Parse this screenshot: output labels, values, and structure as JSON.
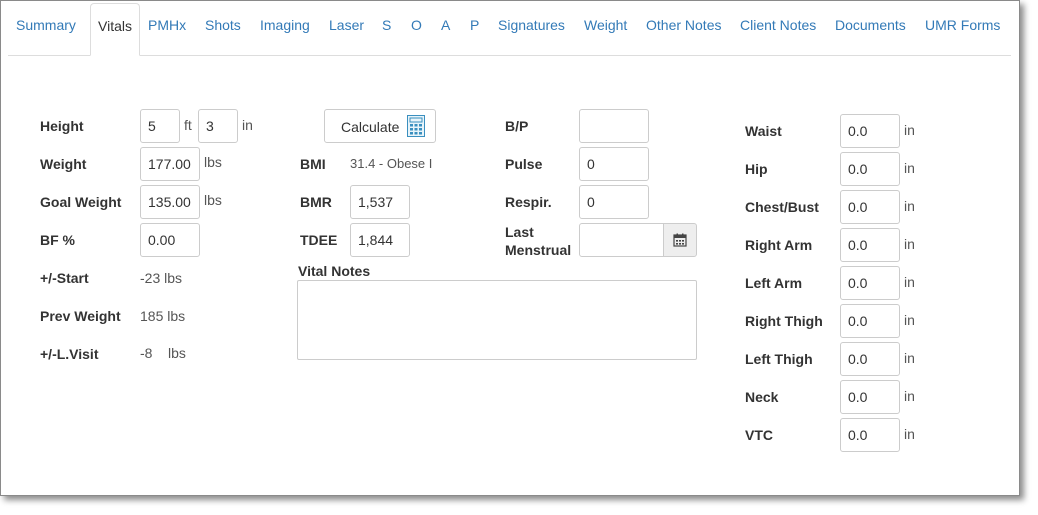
{
  "tabs": [
    {
      "label": "Summary"
    },
    {
      "label": "Vitals"
    },
    {
      "label": "PMHx"
    },
    {
      "label": "Shots"
    },
    {
      "label": "Imaging"
    },
    {
      "label": "Laser"
    },
    {
      "label": "S"
    },
    {
      "label": "O"
    },
    {
      "label": "A"
    },
    {
      "label": "P"
    },
    {
      "label": "Signatures"
    },
    {
      "label": "Weight"
    },
    {
      "label": "Other Notes"
    },
    {
      "label": "Client Notes"
    },
    {
      "label": "Documents"
    },
    {
      "label": "UMR Forms"
    }
  ],
  "active_tab": "Vitals",
  "accent_color": "#337ab7",
  "left": {
    "height": {
      "label": "Height",
      "feet": "5",
      "ft_unit": "ft",
      "inches": "3",
      "in_unit": "in"
    },
    "weight": {
      "label": "Weight",
      "value": "177.00",
      "unit": "lbs"
    },
    "goal_weight": {
      "label": "Goal Weight",
      "value": "135.00",
      "unit": "lbs"
    },
    "bf": {
      "label": "BF %",
      "value": "0.00"
    },
    "start": {
      "label": "+/-Start",
      "value": "-23 lbs"
    },
    "prev_weight": {
      "label": "Prev Weight",
      "value": "185 lbs"
    },
    "last_visit": {
      "label": "+/-L.Visit",
      "value": "-8",
      "unit": "lbs"
    }
  },
  "middle": {
    "calculate_label": "Calculate",
    "bmi": {
      "label": "BMI",
      "value": "31.4 - Obese I"
    },
    "bmr": {
      "label": "BMR",
      "value": "1,537"
    },
    "tdee": {
      "label": "TDEE",
      "value": "1,844"
    },
    "vital_notes_label": "Vital Notes",
    "vital_notes_value": ""
  },
  "vitals": {
    "bp": {
      "label": "B/P",
      "value": ""
    },
    "pulse": {
      "label": "Pulse",
      "value": "0"
    },
    "respir": {
      "label": "Respir.",
      "value": "0"
    },
    "last_menstrual": {
      "label_line1": "Last",
      "label_line2": "Menstrual",
      "value": ""
    }
  },
  "measurements": {
    "unit": "in",
    "items": [
      {
        "label": "Waist",
        "value": "0.0"
      },
      {
        "label": "Hip",
        "value": "0.0"
      },
      {
        "label": "Chest/Bust",
        "value": "0.0"
      },
      {
        "label": "Right Arm",
        "value": "0.0"
      },
      {
        "label": "Left Arm",
        "value": "0.0"
      },
      {
        "label": "Right Thigh",
        "value": "0.0"
      },
      {
        "label": "Left Thigh",
        "value": "0.0"
      },
      {
        "label": "Neck",
        "value": "0.0"
      },
      {
        "label": "VTC",
        "value": "0.0"
      }
    ]
  }
}
